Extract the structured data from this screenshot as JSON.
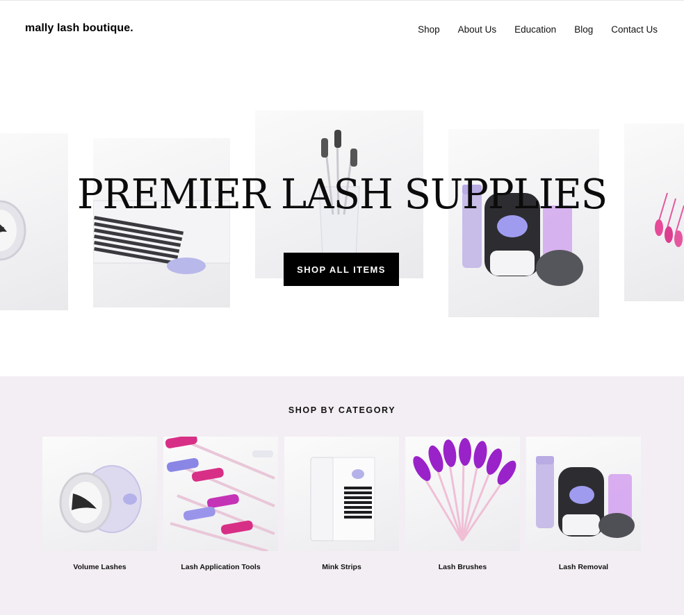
{
  "brand": {
    "logo_text": "mally lash boutique."
  },
  "nav": {
    "items": [
      {
        "label": "Shop"
      },
      {
        "label": "About Us"
      },
      {
        "label": "Education"
      },
      {
        "label": "Blog"
      },
      {
        "label": "Contact Us"
      }
    ]
  },
  "hero": {
    "title": "PREMIER LASH SUPPLIES",
    "button_label": "SHOP ALL ITEMS",
    "images": [
      "mink-lash-case-photo",
      "lash-tray-photo",
      "mascara-wands-cup-photo",
      "lash-removal-kit-photo",
      "pink-lash-brushes-photo"
    ]
  },
  "categories": {
    "heading": "SHOP BY CATEGORY",
    "items": [
      {
        "label": "Volume Lashes",
        "image": "lash-case-photo"
      },
      {
        "label": "Lash Application Tools",
        "image": "spoolie-wands-photo"
      },
      {
        "label": "Mink Strips",
        "image": "lash-tray-photo"
      },
      {
        "label": "Lash Brushes",
        "image": "purple-brushes-fan-photo"
      },
      {
        "label": "Lash Removal",
        "image": "removal-kit-photo"
      }
    ]
  },
  "colors": {
    "category_background": "#f3eef3",
    "button_background": "#000000",
    "accent_lavender": "#b9a8e6",
    "accent_purple": "#9b2fd0",
    "accent_pink": "#e0489a"
  }
}
